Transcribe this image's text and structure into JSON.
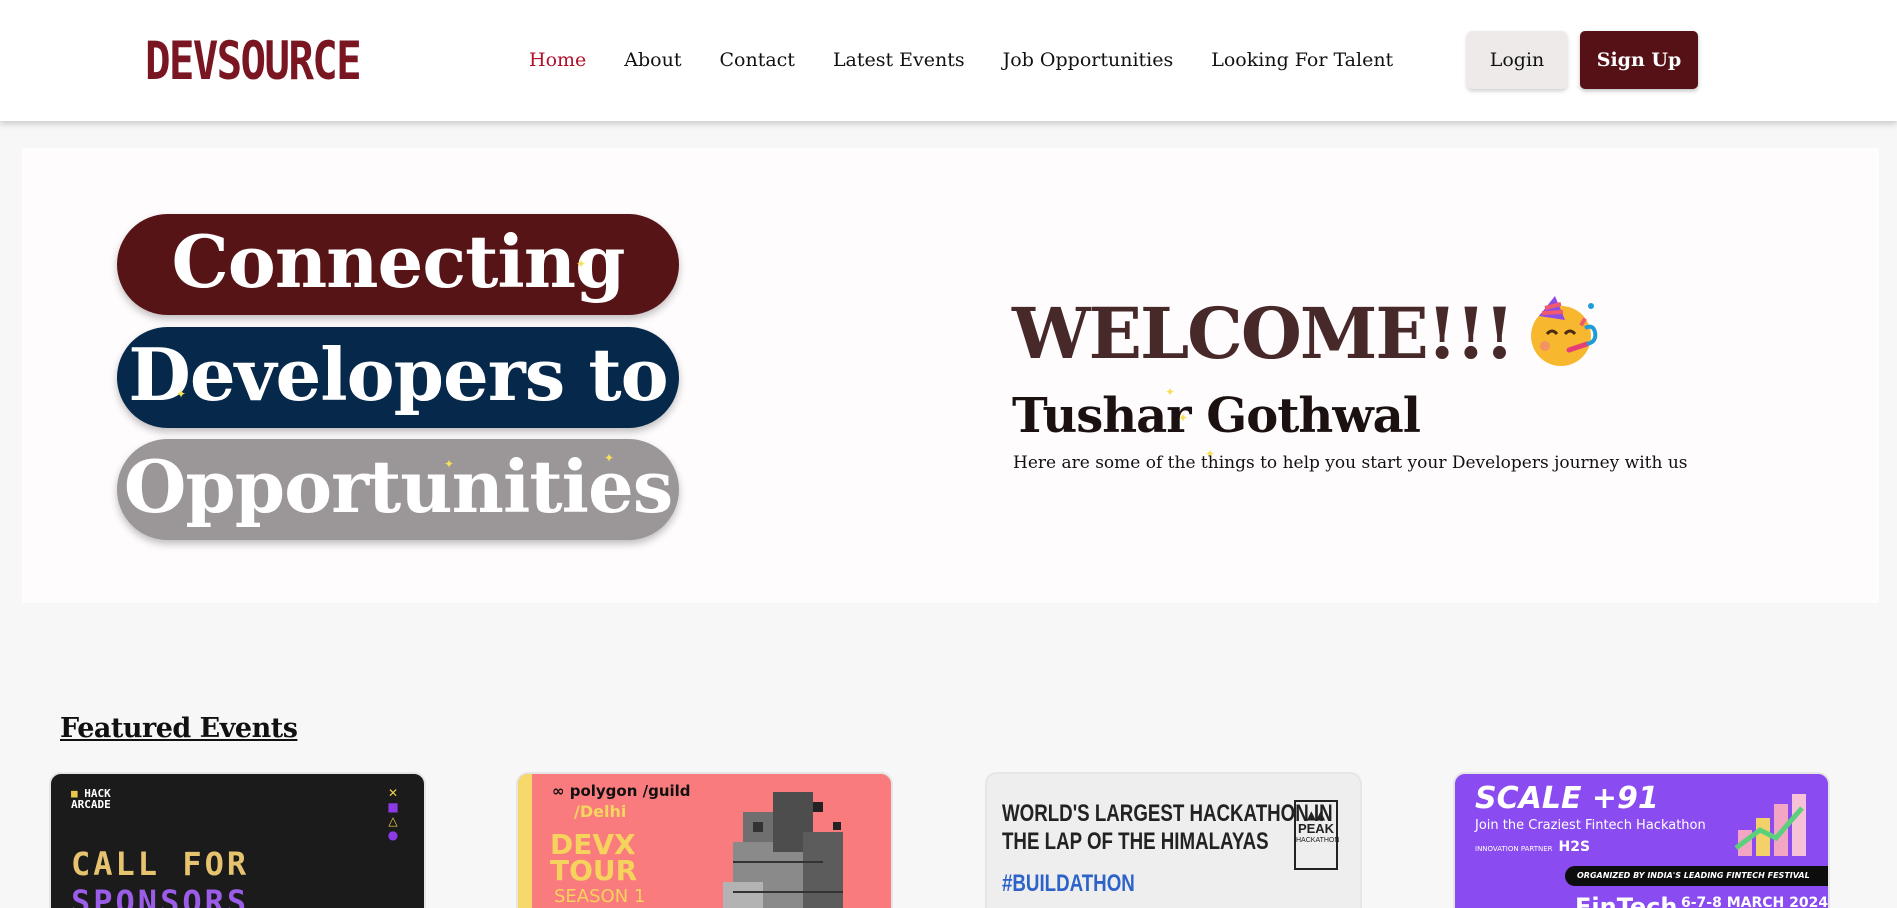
{
  "brand": {
    "logo_text": "DEVSOURCE"
  },
  "nav": {
    "links": [
      {
        "label": "Home",
        "active": true
      },
      {
        "label": "About"
      },
      {
        "label": "Contact"
      },
      {
        "label": "Latest Events"
      },
      {
        "label": "Job Opportunities"
      },
      {
        "label": "Looking For Talent"
      }
    ],
    "login_label": "Login",
    "signup_label": "Sign Up"
  },
  "hero": {
    "taglines": [
      "Connecting",
      "Developers to",
      "Opportunities"
    ],
    "welcome": "WELCOME!!!",
    "welcome_emoji": "partying-face-icon",
    "user_name": "Tushar Gothwal",
    "description": "Here are some of the things to help you start your Developers journey with us"
  },
  "featured": {
    "title": "Featured Events",
    "cards": [
      {
        "brand": "HACK ARCADE",
        "line1": "CALL FOR",
        "line2": "SPONSORS"
      },
      {
        "brand": "polygon /guild",
        "city": "/Delhi",
        "title_line1": "DEVX",
        "title_line2": "TOUR",
        "season": "SEASON 1"
      },
      {
        "headline_line1": "WORLD'S LARGEST HACKATHON IN",
        "headline_line2": "THE LAP OF THE HIMALAYAS",
        "hashtag": "#BUILDATHON",
        "logo_title": "PEAK",
        "logo_sub": "HACKATHON"
      },
      {
        "title": "SCALE +91",
        "subtitle": "Join the Craziest Fintech Hackathon",
        "partner_label": "INNOVATION PARTNER",
        "partner": "H2S",
        "band": "ORGANIZED BY INDIA'S LEADING FINTECH FESTIVAL",
        "brand": "FinTech",
        "date": "6-7-8 MARCH 2024"
      }
    ]
  },
  "colors": {
    "brand_red": "#7a1622",
    "nav_active": "#b0122c",
    "signup_bg": "#551116",
    "pill_1": "#571417",
    "pill_2": "#06284a",
    "pill_3": "#9b9697"
  }
}
